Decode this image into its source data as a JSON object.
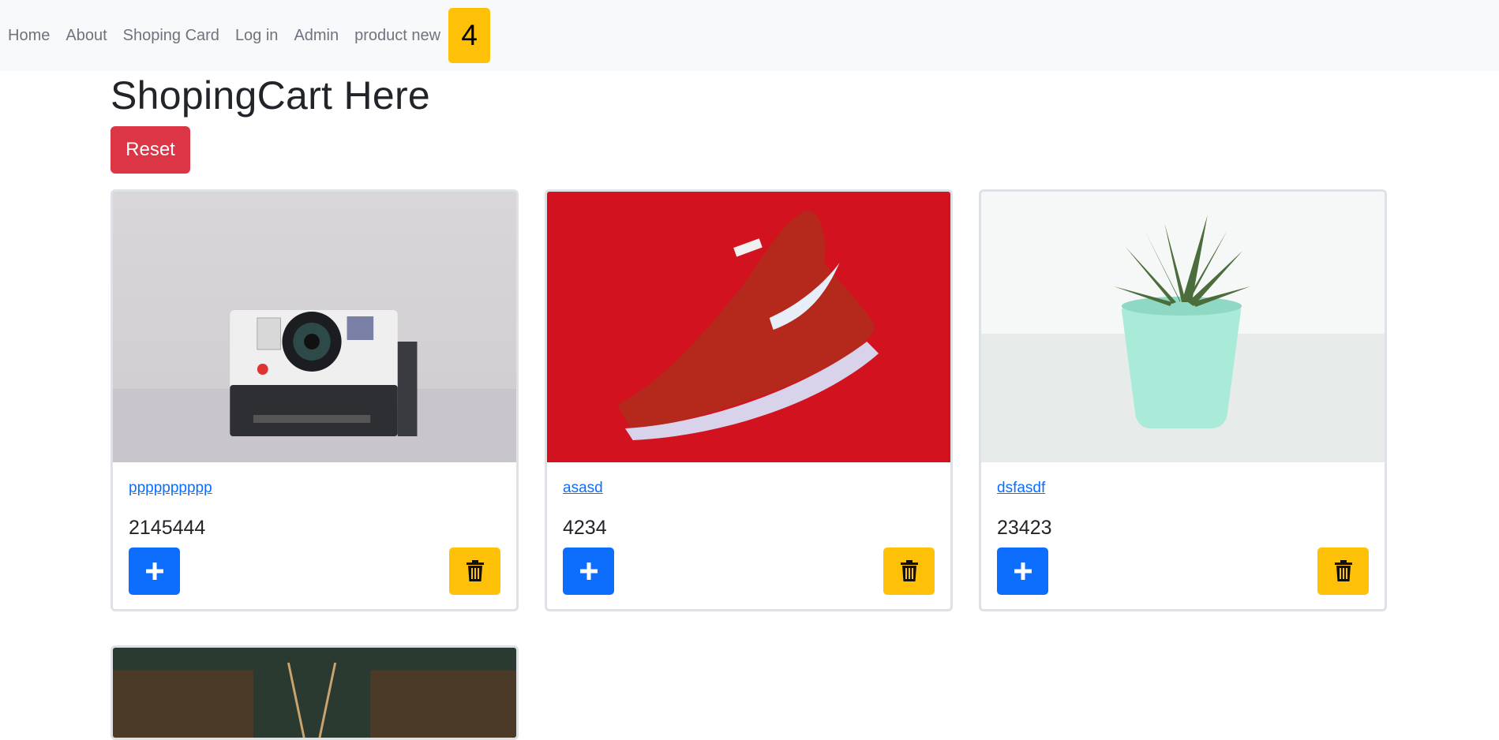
{
  "nav": {
    "items": [
      "Home",
      "About",
      "Shoping Card",
      "Log in",
      "Admin",
      "product new"
    ],
    "cart_count": "4"
  },
  "page": {
    "title": "ShopingCart Here",
    "reset_label": "Reset"
  },
  "products": [
    {
      "name": "pppppppppp",
      "price": "2145444",
      "image": "polaroid-camera"
    },
    {
      "name": "asasd",
      "price": "4234",
      "image": "red-sneaker"
    },
    {
      "name": "dsfasdf",
      "price": "23423",
      "image": "succulent-plant"
    },
    {
      "name": "",
      "price": "",
      "image": "green-photo-partial"
    }
  ],
  "icons": {
    "add": "plus-icon",
    "delete": "trash-icon"
  },
  "colors": {
    "primary": "#0d6efd",
    "warning": "#ffc107",
    "danger": "#dc3545",
    "navbar": "#f8f9fa"
  }
}
